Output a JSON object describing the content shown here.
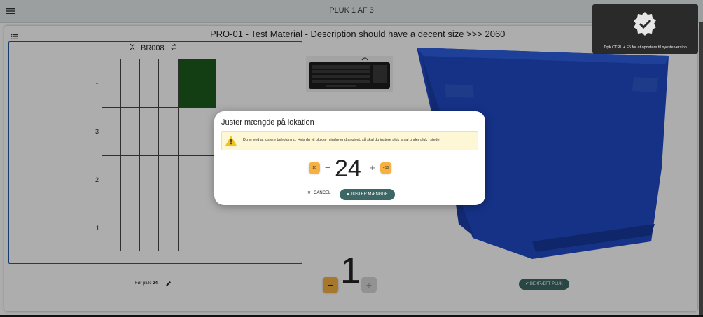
{
  "header": {
    "title": "PLUK 1 AF 3"
  },
  "product": {
    "title": "PRO-01 - Test Material - Description should have a decent size >>> 2060"
  },
  "bin": {
    "code": "BR008",
    "row_labels": [
      "-",
      "3",
      "2",
      "1"
    ],
    "highlight_color": "#1d5a1d"
  },
  "quantity": {
    "value": "1",
    "minus": "−",
    "plus": "+"
  },
  "before_pick": {
    "label": "Før pluk:",
    "value": "24"
  },
  "confirm_button": "BEKRÆFT PLUK",
  "toast": {
    "text": "Tryk CTRL + F5 for at opdatere til nyeste version"
  },
  "dialog": {
    "title": "Juster mængde på lokation",
    "warning": "Du er ved at justere beholdning. Hvis du vil plukke mindre end angivet, så skal du justere pluk antal under pluk i stedet",
    "amount": "24",
    "minus_ten": "10",
    "plus_ten": "+10",
    "minus_label": "−",
    "plus_label": "+",
    "cancel_label": "CANCEL",
    "confirm_label": "JUSTER MÆNGDE"
  },
  "colors": {
    "accent": "#3c6765",
    "warning_bg": "#fdf7d6",
    "orange": "#f5b142",
    "crate_blue": "#1f4bc8"
  }
}
